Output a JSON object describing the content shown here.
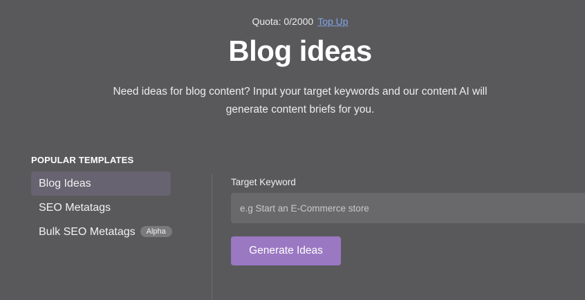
{
  "header": {
    "quota_text": "Quota: 0/2000",
    "top_up_label": "Top Up",
    "title": "Blog ideas",
    "description": "Need ideas for blog content? Input your target keywords and our content AI will generate content briefs for you."
  },
  "sidebar": {
    "heading": "POPULAR TEMPLATES",
    "items": [
      {
        "label": "Blog Ideas",
        "active": true
      },
      {
        "label": "SEO Metatags",
        "active": false
      },
      {
        "label": "Bulk SEO Metatags",
        "active": false,
        "badge": "Alpha"
      }
    ]
  },
  "form": {
    "keyword_label": "Target Keyword",
    "keyword_value": "",
    "keyword_placeholder": "e.g Start an E-Commerce store",
    "submit_label": "Generate Ideas"
  },
  "colors": {
    "background": "#59595c",
    "active_item": "#686370",
    "accent_button": "#9a78c2",
    "link": "#7fa4e6",
    "input_background": "#69696c"
  }
}
